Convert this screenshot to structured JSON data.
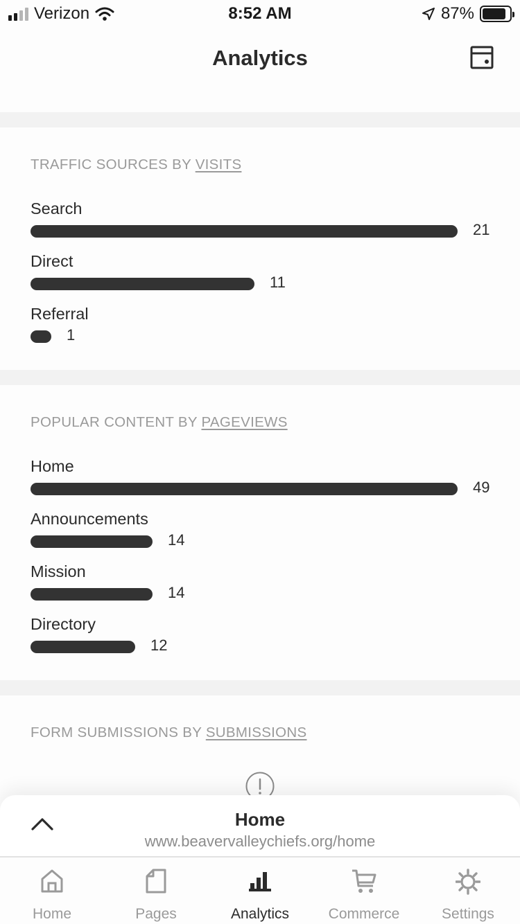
{
  "status_bar": {
    "carrier": "Verizon",
    "time": "8:52 AM",
    "battery_percent": "87%",
    "battery_level": 0.87,
    "signal_bars_active": 2,
    "signal_bars_total": 4
  },
  "header": {
    "title": "Analytics",
    "preview_icon": "site-preview-icon"
  },
  "traffic_sources": {
    "heading_prefix": "TRAFFIC SOURCES BY ",
    "heading_metric": "VISITS",
    "max": 21,
    "rows": [
      {
        "label": "Search",
        "value": 21
      },
      {
        "label": "Direct",
        "value": 11
      },
      {
        "label": "Referral",
        "value": 1
      }
    ]
  },
  "popular_content": {
    "heading_prefix": "POPULAR CONTENT BY ",
    "heading_metric": "PAGEVIEWS",
    "max": 49,
    "rows": [
      {
        "label": "Home",
        "value": 49
      },
      {
        "label": "Announcements",
        "value": 14
      },
      {
        "label": "Mission",
        "value": 14
      },
      {
        "label": "Directory",
        "value": 12
      }
    ]
  },
  "form_submissions": {
    "heading_prefix": "FORM SUBMISSIONS BY ",
    "heading_metric": "SUBMISSIONS",
    "icon": "info-icon"
  },
  "page_panel": {
    "title": "Home",
    "url": "www.beavervalleychiefs.org/home",
    "icon": "chevron-up-icon"
  },
  "tab_bar": {
    "active": "Analytics",
    "tabs": [
      {
        "label": "Home",
        "icon": "home-icon"
      },
      {
        "label": "Pages",
        "icon": "pages-icon"
      },
      {
        "label": "Analytics",
        "icon": "analytics-icon"
      },
      {
        "label": "Commerce",
        "icon": "cart-icon"
      },
      {
        "label": "Settings",
        "icon": "gear-icon"
      }
    ]
  },
  "colors": {
    "bar": "#333333",
    "heading": "#9a9a9a",
    "text": "#2b2b2b",
    "separator": "#f2f2f2",
    "inactive_tab": "#9a9a9a"
  }
}
